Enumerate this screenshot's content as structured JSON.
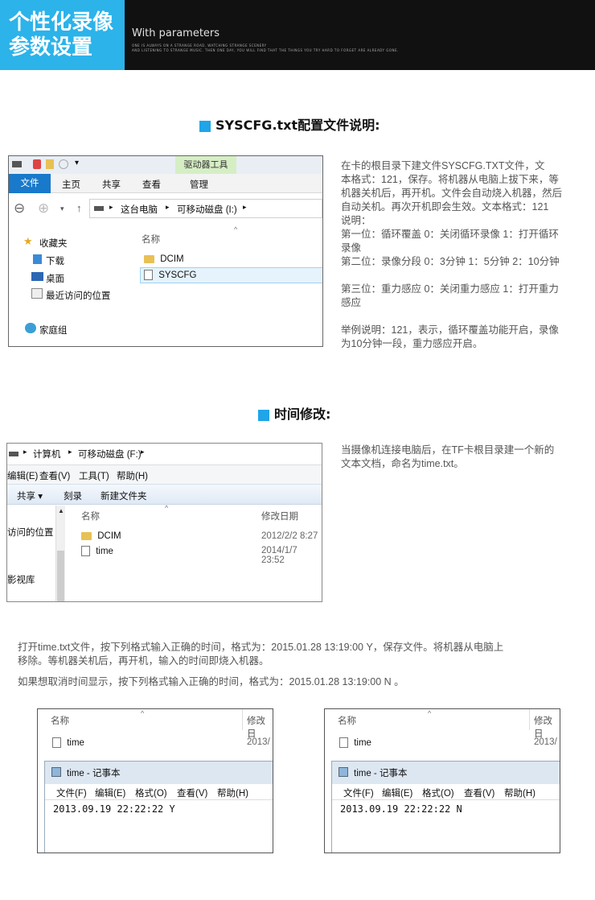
{
  "header": {
    "title_line1": "个性化录像",
    "title_line2": "参数设置",
    "subtitle": "With parameters",
    "small_line1": "ONE IS ALWAYS ON A STRANGE ROAD, WATCHING STRANGE SCENERY",
    "small_line2": "AND LISTENING TO STRANGE MUSIC. THEN ONE DAY, YOU WILL FIND THAT THE THINGS YOU TRY HARD TO FORGET ARE ALREADY GONE."
  },
  "section1": {
    "heading": "SYSCFG.txt配置文件说明:",
    "window": {
      "driver_tools": "驱动器工具",
      "tabs": [
        "文件",
        "主页",
        "共享",
        "查看",
        "管理"
      ],
      "path": [
        "这台电脑",
        "可移动磁盘 (I:)"
      ],
      "nav": [
        "收藏夹",
        "下载",
        "桌面",
        "最近访问的位置",
        "家庭组"
      ],
      "column_name": "名称",
      "files": [
        "DCIM",
        "SYSCFG"
      ]
    },
    "description": [
      "在卡的根目录下建文件SYSCFG.TXT文件，文",
      "本格式：121，保存。将机器从电脑上拔下来，等",
      "机器关机后，再开机。文件会自动烧入机器，然后",
      "自动关机。再次开机即会生效。文本格式：121",
      "说明：",
      "第一位：循环覆盖 0：关闭循环录像 1：打开循环",
      "录像",
      "第二位：录像分段 0：3分钟 1：5分钟 2：10分钟",
      "",
      "第三位：重力感应 0：关闭重力感应 1：打开重力",
      "感应",
      "",
      "举例说明：121，表示，循环覆盖功能开启，录像",
      "为10分钟一段，重力感应开启。"
    ]
  },
  "section2": {
    "heading": "时间修改:",
    "window": {
      "path": [
        "计算机",
        "可移动磁盘 (F:)"
      ],
      "menu": [
        "编辑(E)",
        "查看(V)",
        "工具(T)",
        "帮助(H)"
      ],
      "toolbar": [
        "共享 ▾",
        "刻录",
        "新建文件夹"
      ],
      "nav": [
        "访问的位置",
        "影视库"
      ],
      "col_name": "名称",
      "col_date": "修改日期",
      "files": [
        {
          "name": "DCIM",
          "date": "2012/2/2 8:27"
        },
        {
          "name": "time",
          "date": "2014/1/7 23:52"
        }
      ]
    },
    "description": [
      "当摄像机连接电脑后，在TF卡根目录建一个新的",
      "文本文档，命名为time.txt。"
    ],
    "para1_line1": "打开time.txt文件，按下列格式输入正确的时间，格式为：2015.01.28 13:19:00 Y，保存文件。将机器从电脑上",
    "para1_line2": "移除。等机器关机后，再开机，输入的时间即烧入机器。",
    "para2": "如果想取消时间显示，按下列格式输入正确的时间，格式为：2015.01.28 13:19:00 N 。"
  },
  "notepad_left": {
    "col_name": "名称",
    "col_date": "修改日",
    "file": "time",
    "file_date": "2013/",
    "title": "time - 记事本",
    "menu": [
      "文件(F)",
      "编辑(E)",
      "格式(O)",
      "查看(V)",
      "帮助(H)"
    ],
    "content": "2013.09.19 22:22:22 Y"
  },
  "notepad_right": {
    "col_name": "名称",
    "col_date": "修改日",
    "file": "time",
    "file_date": "2013/",
    "title": "time - 记事本",
    "menu": [
      "文件(F)",
      "编辑(E)",
      "格式(O)",
      "查看(V)",
      "帮助(H)"
    ],
    "content": "2013.09.19 22:22:22 N"
  }
}
